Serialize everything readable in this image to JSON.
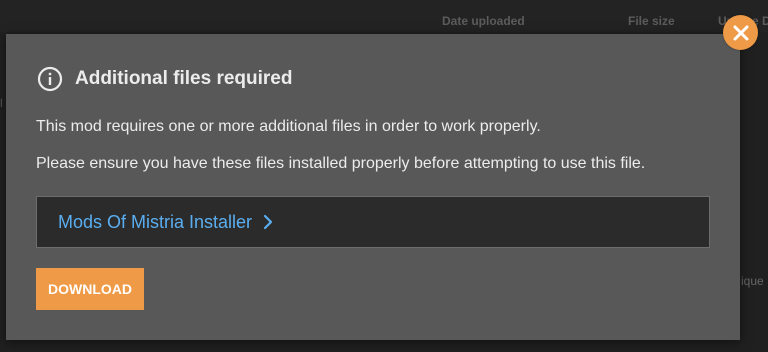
{
  "background": {
    "columns": {
      "date_uploaded": "Date uploaded",
      "file_size": "File size",
      "unique": "Unique D"
    },
    "left_marker": "l",
    "right_text": "ique D"
  },
  "modal": {
    "info_icon": "info-icon",
    "title": "Additional files required",
    "paragraph1": "This mod requires one or more additional files in order to work properly.",
    "paragraph2": "Please ensure you have these files installed properly before attempting to use this file.",
    "required_file": {
      "label": "Mods Of Mistria Installer",
      "icon": "chevron-right-icon"
    },
    "download_label": "DOWNLOAD",
    "close_icon": "close-icon"
  },
  "colors": {
    "accent": "#ef9a46",
    "link": "#5aaef0",
    "modal_bg": "#585858",
    "file_box_bg": "#2b2b2b"
  }
}
